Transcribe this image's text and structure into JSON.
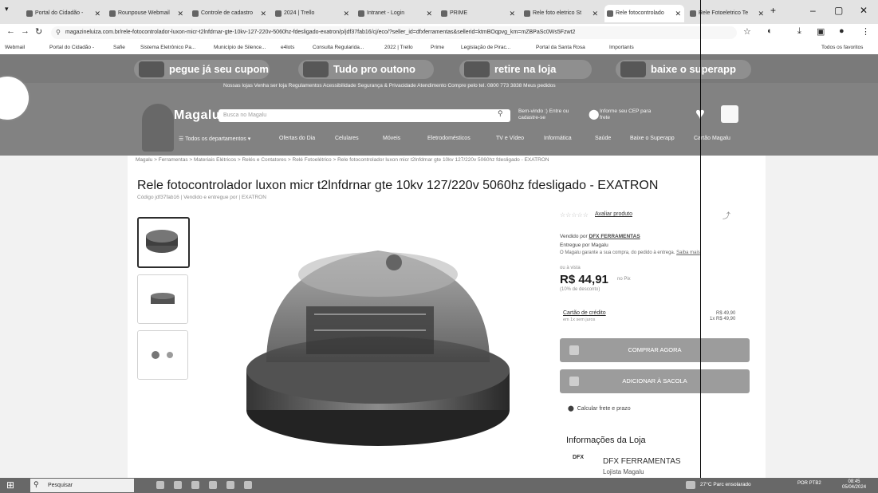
{
  "browser": {
    "tabs": [
      {
        "label": "Portal do Cidadão -"
      },
      {
        "label": "Rounpouse Webmail"
      },
      {
        "label": "Controle de cadastro"
      },
      {
        "label": "2024 | Trello"
      },
      {
        "label": "Intranet - Login"
      },
      {
        "label": "PRIME"
      },
      {
        "label": "Rele foto eletrico St"
      },
      {
        "label": "Rele fotocontrolado"
      },
      {
        "label": "Rele Fotoeletrico Te"
      }
    ],
    "url": "magazineluiza.com.br/rele-fotocontrolador-luxon-micr-t2lnfdrnar-gte-10kv-127-220v-5060hz-fdesligado-exatron/p/jdf37fab16/cj/eco/?seller_id=dfxferramentas&sellerid=ktmBOqpvg_km=mZBPaSc0Ws5Fzwt2",
    "bookmarks": [
      "Webmail",
      "Portal do Cidadão -",
      "Safie",
      "Sistema Eletrônico Pa...",
      "Município de Silence...",
      "e4lots",
      "Consulta Regularida...",
      "2022 | Trello",
      "Prime",
      "Legislação de Pirac...",
      "Portal da Santa Rosa",
      "Importants",
      "Todos os favoritos"
    ]
  },
  "site": {
    "promos": [
      {
        "label": "pegue já seu cupom"
      },
      {
        "label": "Tudo pro outono"
      },
      {
        "label": "retire na loja"
      },
      {
        "label": "baixe o superapp"
      }
    ],
    "toplinks": "Nossas lojas   Venha ser loja   Regulamentos   Acessibilidade   Segurança & Privacidade          Atendimento   Compre pelo tel. 0800 773 3838   Meus pedidos",
    "logo": "Magalu",
    "search_placeholder": "Busca no Magalu",
    "signin": "Bem-vindo :) Entre ou cadastre-se",
    "cep": "Informe seu CEP para frete",
    "nav": [
      "Todos os departamentos",
      "Ofertas do Dia",
      "Celulares",
      "Móveis",
      "Eletrodomésticos",
      "TV e Vídeo",
      "Informática",
      "Saúde",
      "Baixe o Superapp",
      "Cartão Magalu"
    ]
  },
  "product": {
    "breadcrumb": "Magalu  >  Ferramentas  >  Materiais Elétricos  >  Relés e Contatores  >  Relé Fotoelétrico  >  Rele fotocontrolador luxon micr t2lnfdrnar gte 10kv 127/220v 5060hz fdesligado - EXATRON",
    "title": "Rele fotocontrolador luxon micr t2lnfdrnar gte 10kv 127/220v 5060hz fdesligado - EXATRON",
    "code": "Código jdf37fab16  |  Vendido e entregue por | EXATRON",
    "rate_link": "Avaliar produto",
    "sold_by_prefix": "Vendido por",
    "sold_by": "DFX FERRAMENTAS",
    "delivered": "Entregue por Magalu",
    "guarantee": "O Magalu garante a sua compra, do pedido à entrega.",
    "guarantee_link": "Saiba mais",
    "price_label": "ou à vista",
    "price": "R$ 44,91",
    "price_small": "no Pix",
    "discount": "(10% de desconto)",
    "card_label": "Cartão de crédito",
    "card_sub": "em 1x sem juros",
    "card_price": "R$ 49,90",
    "card_price2": "1x R$ 49,90",
    "buy_button": "COMPRAR AGORA",
    "bag_button": "ADICIONAR À SACOLA",
    "freight": "Calcular frete e prazo",
    "store_header": "Informações da Loja",
    "store_logo": "DFX",
    "store_name": "DFX FERRAMENTAS",
    "store_sub": "Lojista Magalu"
  },
  "taskbar": {
    "search": "Pesquisar",
    "weather": "27°C  Parc ensolarado",
    "time": "08:45",
    "date": "05/04/2024",
    "lang": "POR PTB2"
  }
}
